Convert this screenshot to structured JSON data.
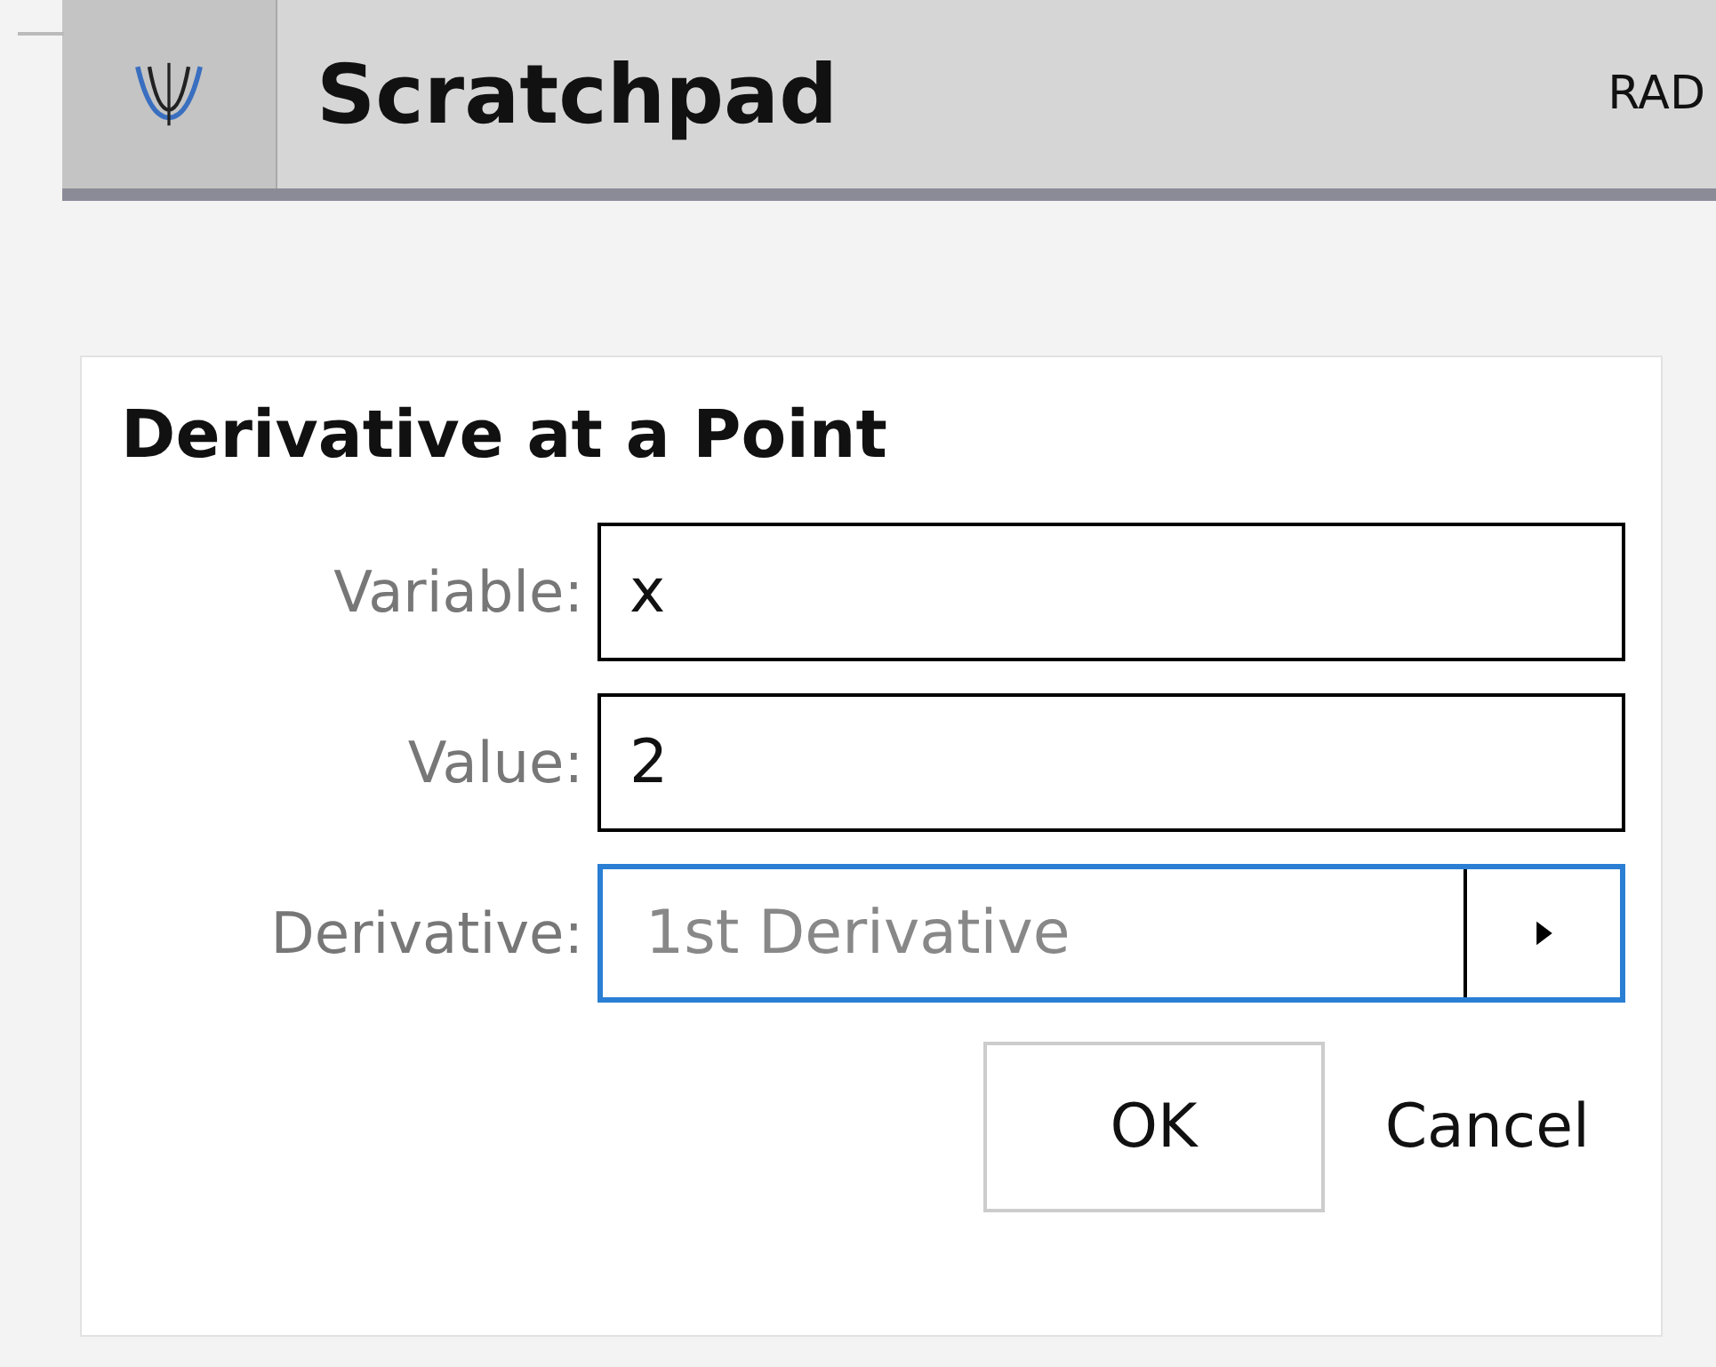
{
  "header": {
    "title": "Scratchpad",
    "mode": "RAD"
  },
  "dialog": {
    "title": "Derivative at a Point",
    "fields": [
      {
        "kind": "input",
        "label": "Variable:",
        "value": "x",
        "focused": false
      },
      {
        "kind": "input",
        "label": "Value:",
        "value": "2",
        "focused": false
      },
      {
        "kind": "dropdown",
        "label": "Derivative:",
        "value": "1st Derivative",
        "focused": true
      }
    ],
    "buttons": [
      {
        "kind": "framed",
        "label": "OK"
      },
      {
        "kind": "plain",
        "label": "Cancel"
      }
    ]
  }
}
